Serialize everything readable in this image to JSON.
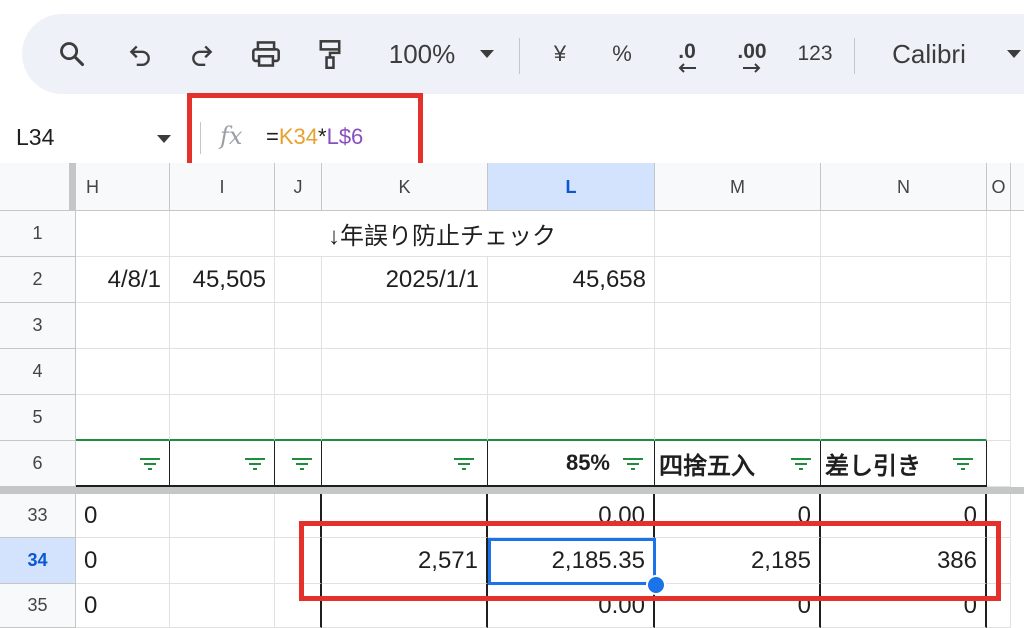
{
  "toolbar": {
    "zoom": "100%",
    "currency": "¥",
    "percent": "%",
    "dec_decrease": ".0",
    "dec_increase": ".00",
    "format_number": "123",
    "font": "Calibri"
  },
  "formula_bar": {
    "cell_ref": "L34",
    "fx": "fx",
    "formula_eq": "=",
    "formula_ref1": "K34",
    "formula_op": "*",
    "formula_ref2": "L$6"
  },
  "columns": [
    "H",
    "I",
    "J",
    "K",
    "L",
    "M",
    "N",
    "O"
  ],
  "rows": {
    "r1": {
      "num": "1",
      "K": "↓年誤り防止チェック"
    },
    "r2": {
      "num": "2",
      "H": "4/8/1",
      "I": "45,505",
      "K": "2025/1/1",
      "L": "45,658"
    },
    "r3": {
      "num": "3"
    },
    "r4": {
      "num": "4"
    },
    "r5": {
      "num": "5"
    },
    "r6": {
      "num": "6",
      "L": "85%",
      "M": "四捨五入",
      "N": "差し引き"
    },
    "r33": {
      "num": "33",
      "H": "0",
      "L": "0.00",
      "M": "0",
      "N": "0"
    },
    "r34": {
      "num": "34",
      "H": "0",
      "K": "2,571",
      "L": "2,185.35",
      "M": "2,185",
      "N": "386"
    },
    "r35": {
      "num": "35",
      "H": "0",
      "L": "0.00",
      "M": "0",
      "N": "0"
    }
  },
  "colors": {
    "highlight": "#e5312b",
    "selection": "#1a73e8"
  }
}
